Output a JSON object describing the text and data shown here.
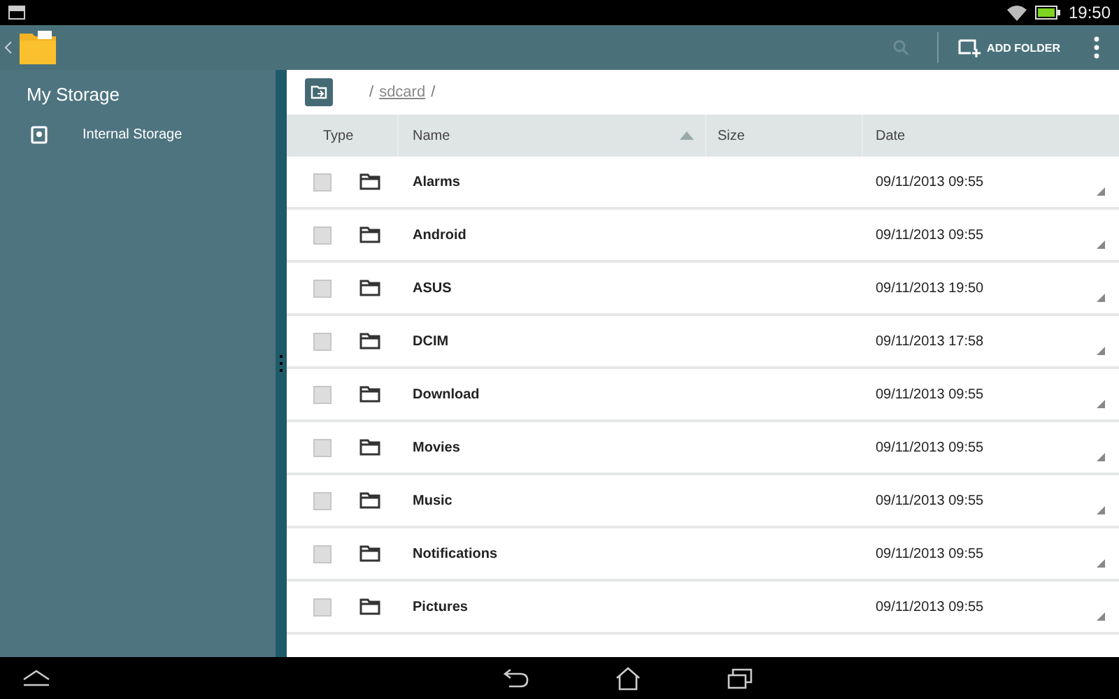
{
  "status_bar": {
    "time": "19:50"
  },
  "action_bar": {
    "add_folder": "ADD FOLDER"
  },
  "sidebar": {
    "title": "My Storage",
    "items": [
      {
        "label": "Internal Storage",
        "selected": false
      }
    ]
  },
  "path": {
    "separator_1": "/",
    "folder": "sdcard",
    "separator_2": "/"
  },
  "table": {
    "columns": [
      {
        "label": "Type",
        "sorted": false
      },
      {
        "label": "Name",
        "sorted": true
      },
      {
        "label": "Size",
        "sorted": false
      },
      {
        "label": "Date",
        "sorted": false
      }
    ],
    "rows": [
      {
        "name": "Alarms",
        "date": "09/11/2013 09:55",
        "checked": false
      },
      {
        "name": "Android",
        "date": "09/11/2013 09:55",
        "checked": false
      },
      {
        "name": "ASUS",
        "date": "09/11/2013 19:50",
        "checked": false
      },
      {
        "name": "DCIM",
        "date": "09/11/2013 17:58",
        "checked": false
      },
      {
        "name": "Download",
        "date": "09/11/2013 09:55",
        "checked": false
      },
      {
        "name": "Movies",
        "date": "09/11/2013 09:55",
        "checked": false
      },
      {
        "name": "Music",
        "date": "09/11/2013 09:55",
        "checked": false
      },
      {
        "name": "Notifications",
        "date": "09/11/2013 09:55",
        "checked": false
      },
      {
        "name": "Pictures",
        "date": "09/11/2013 09:55",
        "checked": false
      }
    ]
  }
}
